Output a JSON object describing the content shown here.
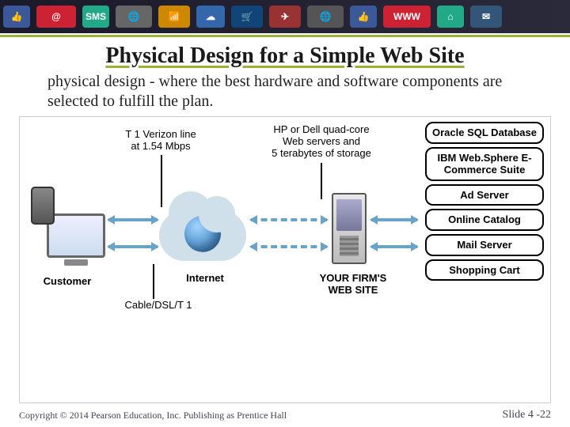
{
  "header": {
    "title": "Physical Design for a Simple Web Site",
    "subtitle": "physical design - where the best hardware and software components are selected to fulfill the plan."
  },
  "diagram": {
    "customer_label": "Customer",
    "internet_label": "Internet",
    "firm_site_label": "YOUR FIRM'S\nWEB SITE",
    "t1_label": "T 1 Verizon line\nat 1.54 Mbps",
    "servers_label": "HP or Dell quad-core\nWeb servers and\n5 terabytes of storage",
    "cable_label": "Cable/DSL/T 1",
    "stack": [
      "Oracle SQL Database",
      "IBM Web.Sphere E-Commerce Suite",
      "Ad Server",
      "Online Catalog",
      "Mail Server",
      "Shopping Cart"
    ]
  },
  "footer": {
    "copyright": "Copyright © 2014 Pearson Education, Inc. Publishing as Prentice Hall",
    "slide": "Slide 4 -22"
  }
}
